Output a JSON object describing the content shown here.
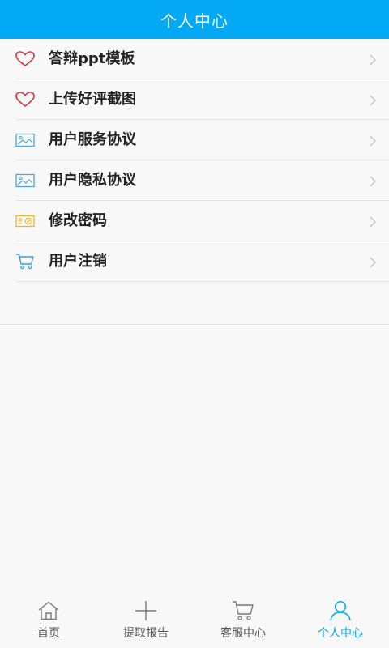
{
  "header": {
    "title": "个人中心"
  },
  "menu": {
    "items": [
      {
        "label": "答辩ppt模板",
        "icon": "heart-icon"
      },
      {
        "label": "上传好评截图",
        "icon": "heart-icon"
      },
      {
        "label": "用户服务协议",
        "icon": "image-icon"
      },
      {
        "label": "用户隐私协议",
        "icon": "image-icon"
      },
      {
        "label": "修改密码",
        "icon": "card-icon"
      },
      {
        "label": "用户注销",
        "icon": "cart-icon"
      }
    ]
  },
  "tabbar": {
    "tabs": [
      {
        "label": "首页",
        "icon": "home-icon"
      },
      {
        "label": "提取报告",
        "icon": "plus-icon"
      },
      {
        "label": "客服中心",
        "icon": "cart-icon"
      },
      {
        "label": "个人中心",
        "icon": "user-icon"
      }
    ],
    "active": "个人中心"
  },
  "colors": {
    "accent": "#03a9f4",
    "heart": "#d9363e",
    "image_icon": "#4aa8d8",
    "card_icon": "#e8b828",
    "cart_icon": "#3aa0d8"
  }
}
